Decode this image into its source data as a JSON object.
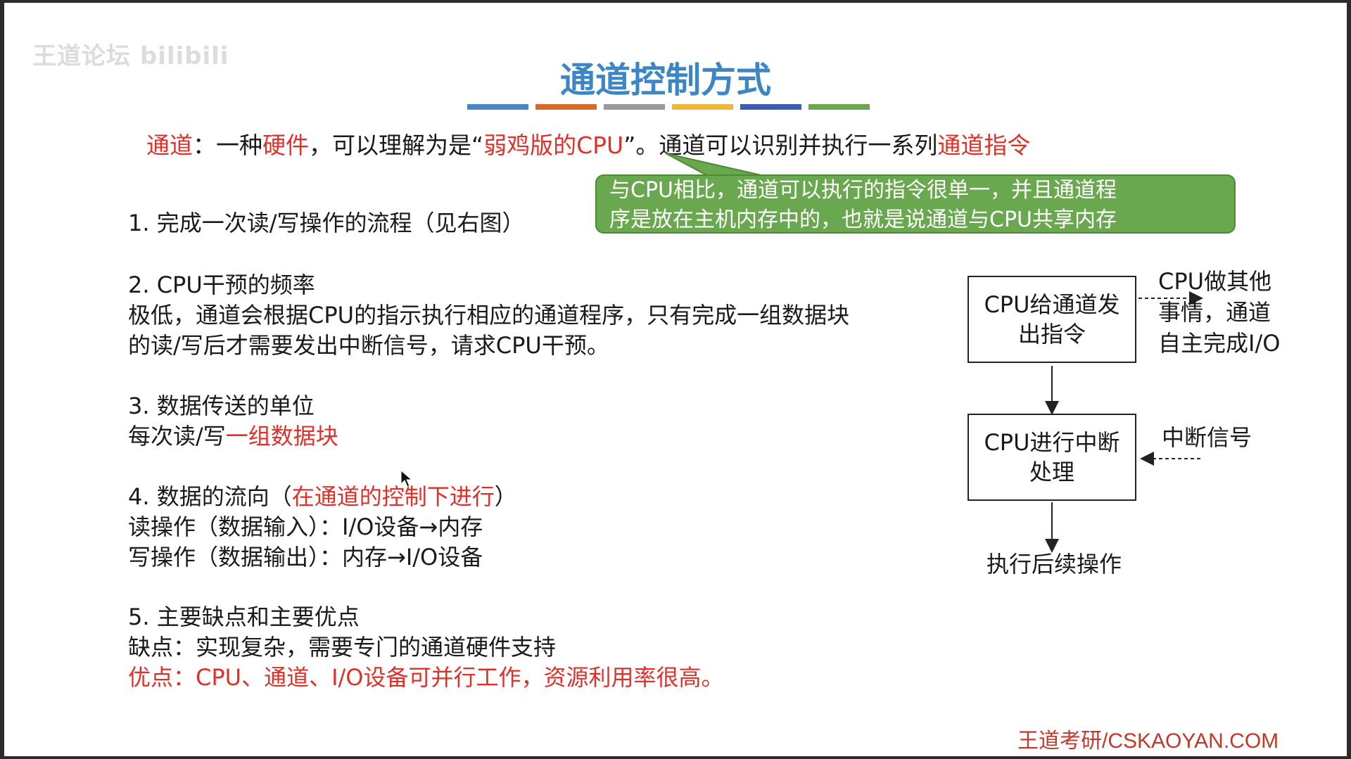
{
  "watermark": "王道论坛 bilibili",
  "title": "通道控制方式",
  "title_bar_colors": [
    "#4a86c8",
    "#d9682d",
    "#9a9a9a",
    "#f0b83a",
    "#3b5fae",
    "#6aa84f"
  ],
  "intro": {
    "p1": "通道",
    "p2": "：一种",
    "p3": "硬件",
    "p4": "，可以理解为是“",
    "p5": "弱鸡版的CPU",
    "p6": "”。通道可以识别并执行一系列",
    "p7": "通道指令"
  },
  "callout": {
    "line1": "与CPU相比，通道可以执行的指令很单一，并且通道程",
    "line2": "序是放在主机内存中的，也就是说通道与CPU共享内存"
  },
  "s1": {
    "heading": "1. 完成一次读/写操作的流程（见右图）"
  },
  "s2": {
    "heading": "2. CPU干预的频率",
    "l1": "极低，通道会根据CPU的指示执行相应的通道程序，只有完成一组数据块",
    "l2": "的读/写后才需要发出中断信号，请求CPU干预。"
  },
  "s3": {
    "heading": "3. 数据传送的单位",
    "l1_pre": "每次读/写",
    "l1_red": "一组数据块"
  },
  "s4": {
    "heading_pre": "4. 数据的流向（",
    "heading_red": "在通道的控制下进行",
    "heading_post": "）",
    "l1": "读操作（数据输入）：I/O设备→内存",
    "l2": "写操作（数据输出）：内存→I/O设备"
  },
  "s5": {
    "heading": "5. 主要缺点和主要优点",
    "l1": "缺点：实现复杂，需要专门的通道硬件支持",
    "l2": "优点：CPU、通道、I/O设备可并行工作，资源利用率很高。"
  },
  "diagram": {
    "box1": "CPU给通道发出指令",
    "box2": "CPU进行中断处理",
    "side1_l1": "CPU做其他",
    "side1_l2": "事情，通道",
    "side1_l3": "自主完成I/O",
    "side2": "中断信号",
    "bottom": "执行后续操作"
  },
  "footer": "王道考研/CSKAOYAN.COM"
}
